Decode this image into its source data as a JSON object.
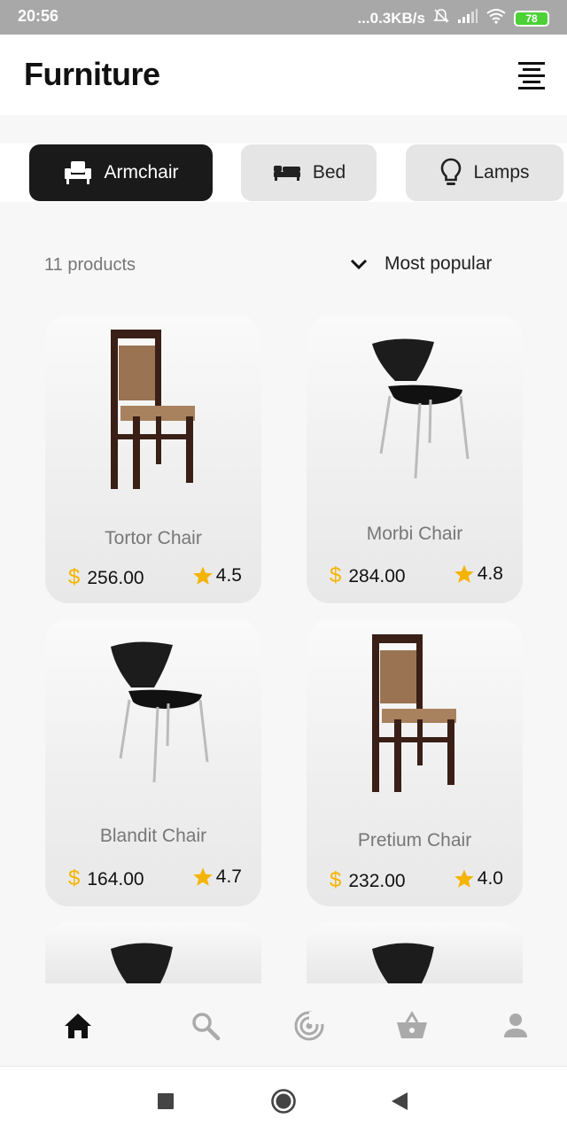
{
  "status_bar": {
    "time": "20:56",
    "network_speed": "...0.3KB/s",
    "battery_level": "78",
    "icons": [
      "mute-icon",
      "signal-icon",
      "wifi-icon",
      "battery-icon"
    ]
  },
  "header": {
    "title": "Furniture",
    "menu_icon": "align-center-icon"
  },
  "categories": [
    {
      "label": "Armchair",
      "icon": "armchair-icon",
      "active": true
    },
    {
      "label": "Bed",
      "icon": "bed-icon",
      "active": false
    },
    {
      "label": "Lamps",
      "icon": "lightbulb-icon",
      "active": false
    }
  ],
  "list": {
    "count_label": "11 products",
    "sort_label": "Most popular"
  },
  "products": [
    {
      "name": "Tortor Chair",
      "currency": "$",
      "price": "256.00",
      "rating": "4.5",
      "image": "wooden-chair"
    },
    {
      "name": "Morbi Chair",
      "currency": "$",
      "price": "284.00",
      "rating": "4.8",
      "image": "black-chair"
    },
    {
      "name": "Blandit Chair",
      "currency": "$",
      "price": "164.00",
      "rating": "4.7",
      "image": "black-chair"
    },
    {
      "name": "Pretium Chair",
      "currency": "$",
      "price": "232.00",
      "rating": "4.0",
      "image": "wooden-chair"
    }
  ],
  "bottom_nav": [
    "home-icon",
    "search-icon",
    "radar-icon",
    "basket-icon",
    "profile-icon"
  ],
  "colors": {
    "accent": "#f5b400",
    "active_tab": "#1a1a1a",
    "inactive_tab": "#e5e5e5",
    "status_bar": "#a8a8a8"
  }
}
